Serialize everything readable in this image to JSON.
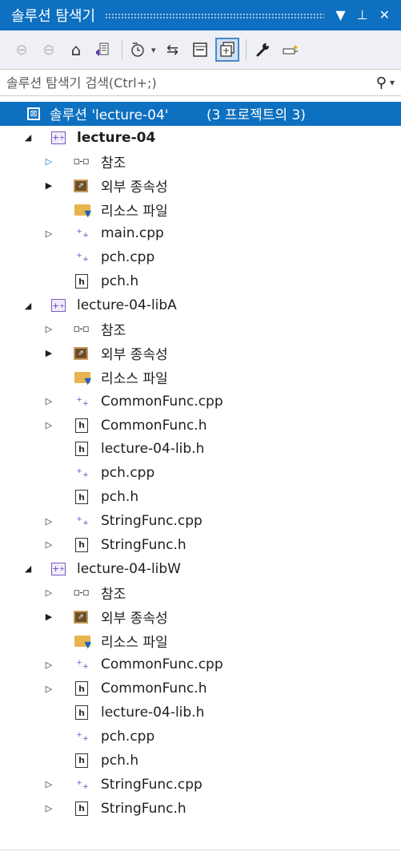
{
  "window": {
    "title": "솔루션 탐색기",
    "dropdown_icon": "▼",
    "pin_icon": "ᚙ",
    "close_icon": "✕"
  },
  "toolbar": {
    "back_icon": "back-icon",
    "forward_icon": "forward-icon",
    "home_icon": "home-icon",
    "switch_views_icon": "switch-views-icon",
    "pending_changes_icon": "pending-changes-icon",
    "sync_icon": "sync-icon",
    "collapse_all_icon": "collapse-all-icon",
    "show_all_files_icon": "show-all-files-icon",
    "properties_icon": "wrench-icon",
    "preview_icon": "preview-icon"
  },
  "search": {
    "placeholder": "솔루션 탐색기 검색(Ctrl+;)"
  },
  "tree": {
    "solution": {
      "label": "솔루션 'lecture-04'",
      "count": "(3 프로젝트의 3)"
    },
    "projects": [
      {
        "name": "lecture-04",
        "items": {
          "refs": "참조",
          "ext": "외부 종속성",
          "res": "리소스 파일",
          "f1": "main.cpp",
          "f2": "pch.cpp",
          "f3": "pch.h"
        }
      },
      {
        "name": "lecture-04-libA",
        "items": {
          "refs": "참조",
          "ext": "외부 종속성",
          "res": "리소스 파일",
          "f1": "CommonFunc.cpp",
          "f2": "CommonFunc.h",
          "f3": "lecture-04-lib.h",
          "f4": "pch.cpp",
          "f5": "pch.h",
          "f6": "StringFunc.cpp",
          "f7": "StringFunc.h"
        }
      },
      {
        "name": "lecture-04-libW",
        "items": {
          "refs": "참조",
          "ext": "외부 종속성",
          "res": "리소스 파일",
          "f1": "CommonFunc.cpp",
          "f2": "CommonFunc.h",
          "f3": "lecture-04-lib.h",
          "f4": "pch.cpp",
          "f5": "pch.h",
          "f6": "StringFunc.cpp",
          "f7": "StringFunc.h"
        }
      }
    ]
  },
  "colors": {
    "accent": "#0e70c0",
    "cpp_icon": "#7a3fc0",
    "folder": "#e8b450"
  }
}
